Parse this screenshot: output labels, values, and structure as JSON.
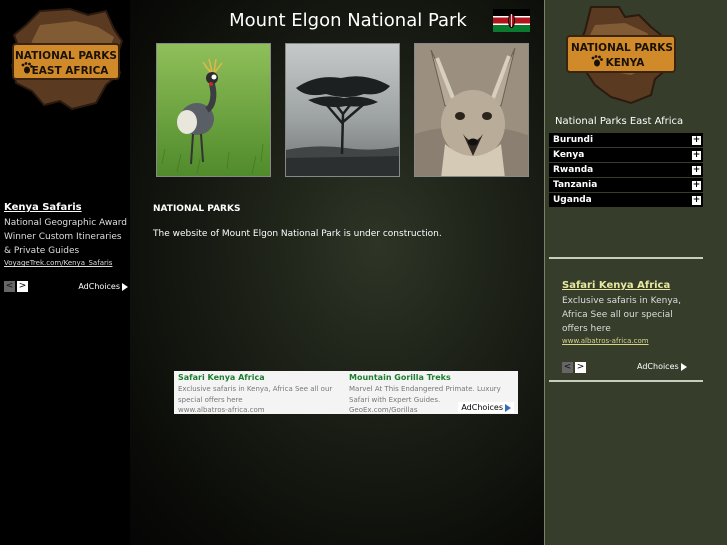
{
  "header": {
    "title": "Mount Elgon National Park",
    "flag_icon": "kenya-flag-icon"
  },
  "logos": {
    "left": {
      "line1": "NATIONAL PARKS",
      "line2": "EAST AFRICA"
    },
    "right": {
      "line1": "NATIONAL PARKS",
      "line2": "KENYA"
    }
  },
  "photos": [
    {
      "name": "crowned-crane-photo"
    },
    {
      "name": "acacia-tree-photo"
    },
    {
      "name": "bat-eared-fox-photo"
    }
  ],
  "main": {
    "section_heading": "NATIONAL PARKS",
    "body_text": "The website of Mount Elgon National Park is under construction."
  },
  "left_ad": {
    "title": "Kenya Safaris",
    "body": "National Geographic Award Winner Custom Itineraries & Private Guides",
    "url": "VoyageTrek.com/Kenya_Safaris",
    "adchoices": "AdChoices",
    "prev": "<",
    "next": ">"
  },
  "center_ad": {
    "ads": [
      {
        "title": "Safari Kenya Africa",
        "body": "Exclusive safaris in Kenya, Africa See all our special offers here",
        "url": "www.albatros-africa.com"
      },
      {
        "title": "Mountain Gorilla Treks",
        "body": "Marvel At This Endangered Primate. Luxury Safari with Expert Guides.",
        "url": "GeoEx.com/Gorillas"
      }
    ],
    "adchoices": "AdChoices"
  },
  "sidebar": {
    "heading": "National Parks East Africa",
    "items": [
      {
        "label": "Burundi"
      },
      {
        "label": "Kenya"
      },
      {
        "label": "Rwanda"
      },
      {
        "label": "Tanzania"
      },
      {
        "label": "Uganda"
      }
    ],
    "expand_symbol": "+"
  },
  "right_ad": {
    "title": "Safari Kenya Africa",
    "body": "Exclusive safaris in Kenya, Africa See all our special offers here",
    "url": "www.albatros-africa.com",
    "adchoices": "AdChoices",
    "prev": "<",
    "next": ">"
  },
  "colors": {
    "right_panel": "#363d2b",
    "ad_title_center": "#1e7d2f",
    "logo_wood": "#c98a2e"
  }
}
